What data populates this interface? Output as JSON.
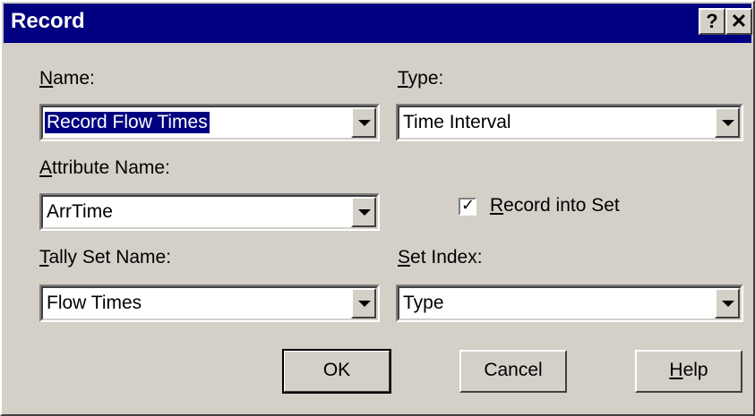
{
  "window": {
    "title": "Record"
  },
  "titlebar": {
    "help_label": "?",
    "close_label": "✕"
  },
  "fields": {
    "name": {
      "label_key": "N",
      "label_rest": "ame:",
      "value": "Record Flow Times"
    },
    "type": {
      "label_key": "T",
      "label_rest": "ype:",
      "value": "Time Interval"
    },
    "attribute_name": {
      "label_key": "A",
      "label_rest": "ttribute Name:",
      "value": "ArrTime"
    },
    "tally_set_name": {
      "label_key": "T",
      "label_rest": "ally Set Name:",
      "value": "Flow Times"
    },
    "set_index": {
      "label_key": "S",
      "label_rest": "et Index:",
      "value": "Type"
    }
  },
  "record_into_set": {
    "label_key": "R",
    "label_rest": "ecord into Set",
    "checked": true
  },
  "buttons": {
    "ok": "OK",
    "cancel": "Cancel",
    "help_key": "H",
    "help_rest": "elp"
  },
  "colors": {
    "titlebar": "#000080",
    "face": "#d4d0c8",
    "selection": "#000080"
  }
}
